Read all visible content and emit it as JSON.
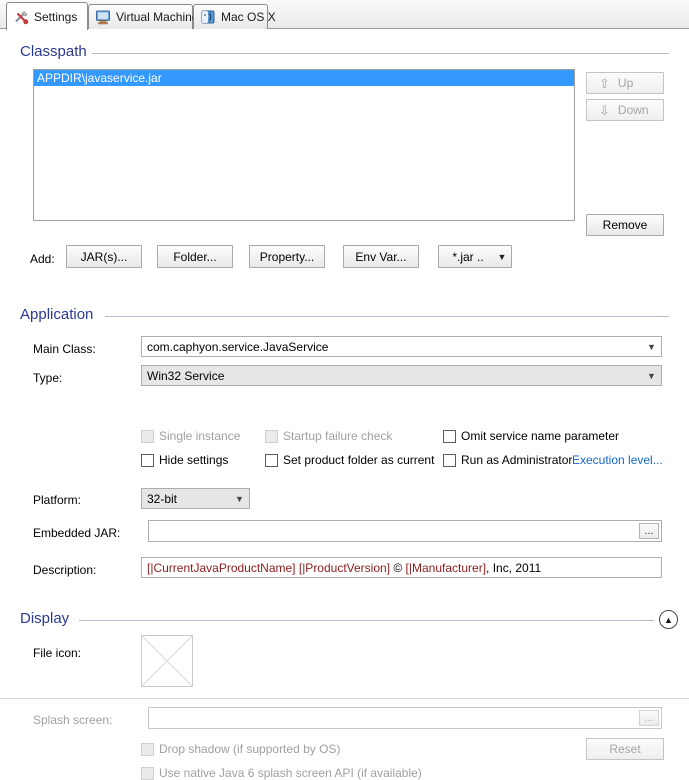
{
  "window": {
    "title": "Settings"
  },
  "tabs": [
    {
      "label": "Settings",
      "icon": "tools-icon",
      "selected": true
    },
    {
      "label": "Virtual Machine",
      "icon": "monitor-icon",
      "selected": false
    },
    {
      "label": "Mac OS X",
      "icon": "apple-finder-icon",
      "selected": false
    }
  ],
  "classpath": {
    "group_label": "Classpath",
    "items": [
      {
        "text": "APPDIR\\javaservice.jar",
        "selected": true
      }
    ],
    "up_label": "Up",
    "down_label": "Down",
    "remove_label": "Remove",
    "up_enabled": false,
    "down_enabled": false,
    "add_label": "Add:",
    "add_buttons": [
      "JAR(s)...",
      "Folder...",
      "Property...",
      "Env Var..."
    ],
    "filter_button": "*.jar .."
  },
  "application": {
    "group_label": "Application",
    "main_class_label": "Main Class:",
    "main_class_value": "com.caphyon.service.JavaService",
    "type_label": "Type:",
    "type_value": "Win32 Service",
    "checkboxes": [
      {
        "label": "Single instance",
        "checked": false,
        "enabled": false
      },
      {
        "label": "Startup failure check",
        "checked": false,
        "enabled": false
      },
      {
        "label": "Omit service name parameter",
        "checked": false,
        "enabled": true
      },
      {
        "label": "Hide settings",
        "checked": false,
        "enabled": true
      },
      {
        "label": "Set product folder as current",
        "checked": false,
        "enabled": true
      },
      {
        "label": "Run as Administrator",
        "checked": false,
        "enabled": true
      }
    ],
    "execution_level_link": "Execution level...",
    "platform_label": "Platform:",
    "platform_value": "32-bit",
    "embedded_jar_label": "Embedded JAR:",
    "embedded_jar_value": "",
    "browse_label": "...",
    "description_label": "Description:",
    "description_parts": [
      {
        "text": "[|CurrentJavaProductName]",
        "style": "token"
      },
      {
        "text": " ",
        "style": "plain"
      },
      {
        "text": "[|ProductVersion]",
        "style": "token"
      },
      {
        "text": " © ",
        "style": "plain"
      },
      {
        "text": "[|Manufacturer]",
        "style": "token"
      },
      {
        "text": ", Inc, 2011",
        "style": "plain"
      }
    ]
  },
  "display": {
    "group_label": "Display",
    "collapse_icon": "chevron-up-icon",
    "file_icon_label": "File icon:",
    "file_icon_placeholder": "empty-image-icon",
    "splash_label": "Splash screen:",
    "splash_value": "",
    "splash_browse": "...",
    "drop_shadow_label": "Drop shadow (if supported by OS)",
    "native_splash_label": "Use native Java 6 splash screen API (if available)",
    "reset_label": "Reset",
    "enabled": false
  },
  "colors": {
    "group_heading": "#2b3a8f",
    "selection": "#3399ff",
    "link": "#1569c7",
    "token_red": "#8c1c1c",
    "disabled_text": "#a0a0a0"
  }
}
